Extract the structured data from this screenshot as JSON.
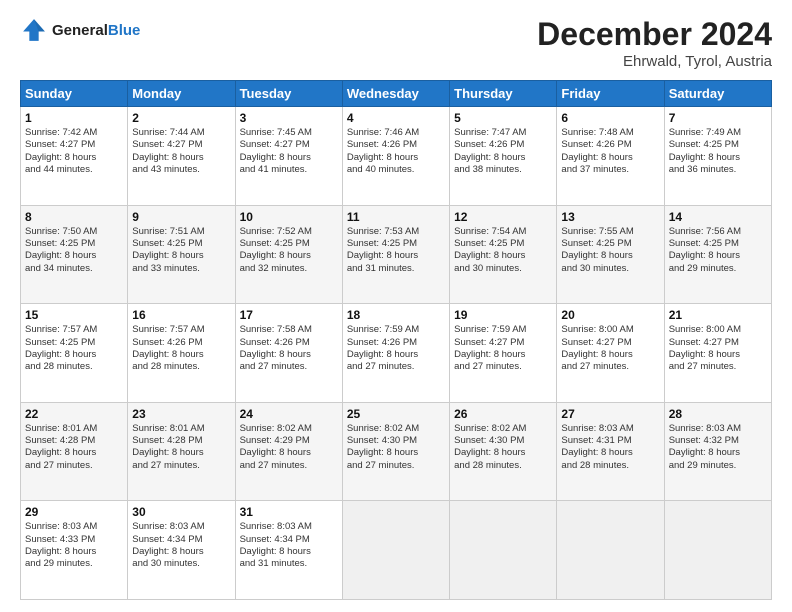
{
  "logo": {
    "line1": "General",
    "line2": "Blue"
  },
  "title": "December 2024",
  "subtitle": "Ehrwald, Tyrol, Austria",
  "days_of_week": [
    "Sunday",
    "Monday",
    "Tuesday",
    "Wednesday",
    "Thursday",
    "Friday",
    "Saturday"
  ],
  "weeks": [
    [
      {
        "day": "1",
        "lines": [
          "Sunrise: 7:42 AM",
          "Sunset: 4:27 PM",
          "Daylight: 8 hours",
          "and 44 minutes."
        ]
      },
      {
        "day": "2",
        "lines": [
          "Sunrise: 7:44 AM",
          "Sunset: 4:27 PM",
          "Daylight: 8 hours",
          "and 43 minutes."
        ]
      },
      {
        "day": "3",
        "lines": [
          "Sunrise: 7:45 AM",
          "Sunset: 4:27 PM",
          "Daylight: 8 hours",
          "and 41 minutes."
        ]
      },
      {
        "day": "4",
        "lines": [
          "Sunrise: 7:46 AM",
          "Sunset: 4:26 PM",
          "Daylight: 8 hours",
          "and 40 minutes."
        ]
      },
      {
        "day": "5",
        "lines": [
          "Sunrise: 7:47 AM",
          "Sunset: 4:26 PM",
          "Daylight: 8 hours",
          "and 38 minutes."
        ]
      },
      {
        "day": "6",
        "lines": [
          "Sunrise: 7:48 AM",
          "Sunset: 4:26 PM",
          "Daylight: 8 hours",
          "and 37 minutes."
        ]
      },
      {
        "day": "7",
        "lines": [
          "Sunrise: 7:49 AM",
          "Sunset: 4:25 PM",
          "Daylight: 8 hours",
          "and 36 minutes."
        ]
      }
    ],
    [
      {
        "day": "8",
        "lines": [
          "Sunrise: 7:50 AM",
          "Sunset: 4:25 PM",
          "Daylight: 8 hours",
          "and 34 minutes."
        ]
      },
      {
        "day": "9",
        "lines": [
          "Sunrise: 7:51 AM",
          "Sunset: 4:25 PM",
          "Daylight: 8 hours",
          "and 33 minutes."
        ]
      },
      {
        "day": "10",
        "lines": [
          "Sunrise: 7:52 AM",
          "Sunset: 4:25 PM",
          "Daylight: 8 hours",
          "and 32 minutes."
        ]
      },
      {
        "day": "11",
        "lines": [
          "Sunrise: 7:53 AM",
          "Sunset: 4:25 PM",
          "Daylight: 8 hours",
          "and 31 minutes."
        ]
      },
      {
        "day": "12",
        "lines": [
          "Sunrise: 7:54 AM",
          "Sunset: 4:25 PM",
          "Daylight: 8 hours",
          "and 30 minutes."
        ]
      },
      {
        "day": "13",
        "lines": [
          "Sunrise: 7:55 AM",
          "Sunset: 4:25 PM",
          "Daylight: 8 hours",
          "and 30 minutes."
        ]
      },
      {
        "day": "14",
        "lines": [
          "Sunrise: 7:56 AM",
          "Sunset: 4:25 PM",
          "Daylight: 8 hours",
          "and 29 minutes."
        ]
      }
    ],
    [
      {
        "day": "15",
        "lines": [
          "Sunrise: 7:57 AM",
          "Sunset: 4:25 PM",
          "Daylight: 8 hours",
          "and 28 minutes."
        ]
      },
      {
        "day": "16",
        "lines": [
          "Sunrise: 7:57 AM",
          "Sunset: 4:26 PM",
          "Daylight: 8 hours",
          "and 28 minutes."
        ]
      },
      {
        "day": "17",
        "lines": [
          "Sunrise: 7:58 AM",
          "Sunset: 4:26 PM",
          "Daylight: 8 hours",
          "and 27 minutes."
        ]
      },
      {
        "day": "18",
        "lines": [
          "Sunrise: 7:59 AM",
          "Sunset: 4:26 PM",
          "Daylight: 8 hours",
          "and 27 minutes."
        ]
      },
      {
        "day": "19",
        "lines": [
          "Sunrise: 7:59 AM",
          "Sunset: 4:27 PM",
          "Daylight: 8 hours",
          "and 27 minutes."
        ]
      },
      {
        "day": "20",
        "lines": [
          "Sunrise: 8:00 AM",
          "Sunset: 4:27 PM",
          "Daylight: 8 hours",
          "and 27 minutes."
        ]
      },
      {
        "day": "21",
        "lines": [
          "Sunrise: 8:00 AM",
          "Sunset: 4:27 PM",
          "Daylight: 8 hours",
          "and 27 minutes."
        ]
      }
    ],
    [
      {
        "day": "22",
        "lines": [
          "Sunrise: 8:01 AM",
          "Sunset: 4:28 PM",
          "Daylight: 8 hours",
          "and 27 minutes."
        ]
      },
      {
        "day": "23",
        "lines": [
          "Sunrise: 8:01 AM",
          "Sunset: 4:28 PM",
          "Daylight: 8 hours",
          "and 27 minutes."
        ]
      },
      {
        "day": "24",
        "lines": [
          "Sunrise: 8:02 AM",
          "Sunset: 4:29 PM",
          "Daylight: 8 hours",
          "and 27 minutes."
        ]
      },
      {
        "day": "25",
        "lines": [
          "Sunrise: 8:02 AM",
          "Sunset: 4:30 PM",
          "Daylight: 8 hours",
          "and 27 minutes."
        ]
      },
      {
        "day": "26",
        "lines": [
          "Sunrise: 8:02 AM",
          "Sunset: 4:30 PM",
          "Daylight: 8 hours",
          "and 28 minutes."
        ]
      },
      {
        "day": "27",
        "lines": [
          "Sunrise: 8:03 AM",
          "Sunset: 4:31 PM",
          "Daylight: 8 hours",
          "and 28 minutes."
        ]
      },
      {
        "day": "28",
        "lines": [
          "Sunrise: 8:03 AM",
          "Sunset: 4:32 PM",
          "Daylight: 8 hours",
          "and 29 minutes."
        ]
      }
    ],
    [
      {
        "day": "29",
        "lines": [
          "Sunrise: 8:03 AM",
          "Sunset: 4:33 PM",
          "Daylight: 8 hours",
          "and 29 minutes."
        ]
      },
      {
        "day": "30",
        "lines": [
          "Sunrise: 8:03 AM",
          "Sunset: 4:34 PM",
          "Daylight: 8 hours",
          "and 30 minutes."
        ]
      },
      {
        "day": "31",
        "lines": [
          "Sunrise: 8:03 AM",
          "Sunset: 4:34 PM",
          "Daylight: 8 hours",
          "and 31 minutes."
        ]
      },
      {
        "day": "",
        "lines": []
      },
      {
        "day": "",
        "lines": []
      },
      {
        "day": "",
        "lines": []
      },
      {
        "day": "",
        "lines": []
      }
    ]
  ]
}
